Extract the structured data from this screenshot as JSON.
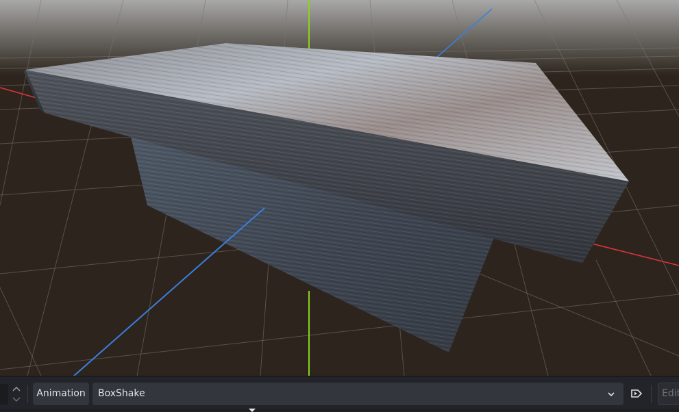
{
  "viewport": {
    "sky_color": "#9a9a9a",
    "ground_color": "#2d251d",
    "axis_colors": {
      "x": "#e0343c",
      "y": "#8ad21e",
      "z": "#3a7fe0"
    },
    "scene_object": "wooden-box"
  },
  "toolbar": {
    "animation_label": "Animation",
    "selected_animation": "BoxShake",
    "edit_label": "Edit",
    "icons": {
      "spin": "up-down-arrows",
      "dropdown": "chevron-down-icon",
      "autoplay": "autoplay-icon"
    }
  }
}
